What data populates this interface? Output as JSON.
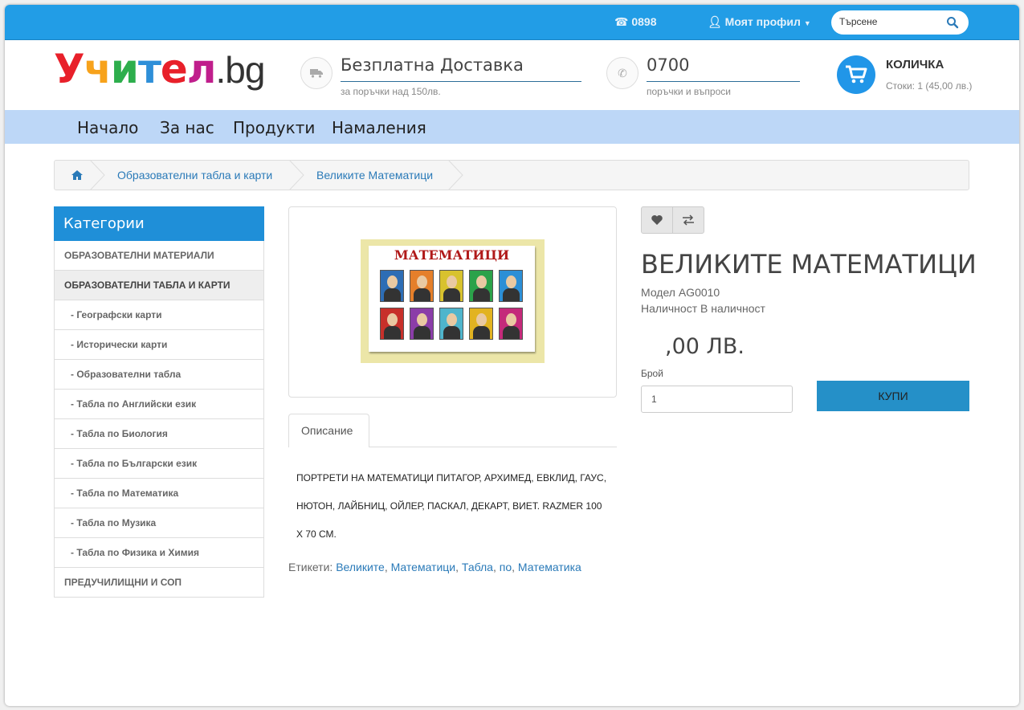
{
  "topbar": {
    "phone": "0898",
    "profile": "Моят профил",
    "search_placeholder": "Търсене"
  },
  "header": {
    "logo_letters": [
      "У",
      "ч",
      "и",
      "т",
      "е",
      "л"
    ],
    "logo_colors": [
      "#e8202a",
      "#f7a21b",
      "#2dae4c",
      "#2e8fd8",
      "#e8202a",
      "#c01e8c"
    ],
    "logo_suffix": ".bg",
    "delivery_title": "Безплатна Доставка",
    "delivery_sub": "за поръчки над 150лв.",
    "phone_title": "0700 ",
    "phone_sub": "поръчки и въпроси",
    "cart_title": "КОЛИЧКА",
    "cart_sub": "Стоки: 1 (45,00 лв.)"
  },
  "nav": {
    "items": [
      "Начало",
      "За нас",
      "Продукти",
      "Намаления"
    ]
  },
  "breadcrumb": {
    "items": [
      "Образователни табла и карти",
      "Великите Математици"
    ]
  },
  "sidebar": {
    "title": "Категории",
    "items": [
      "ОБРАЗОВАТЕЛНИ МАТЕРИАЛИ",
      "ОБРАЗОВАТЕЛНИ ТАБЛА И КАРТИ",
      "- Географски карти",
      "- Исторически карти",
      "- Образователни табла",
      "- Табла по Английски език",
      "- Табла по Биология",
      "- Табла по Български език",
      "- Табла по Математика",
      "- Табла по Музика",
      "- Табла по Физика и Химия",
      "ПРЕДУЧИЛИЩНИ И СОП"
    ]
  },
  "product": {
    "poster_title": "МАТЕМАТИЦИ",
    "title": "ВЕЛИКИТЕ МАТЕМАТИЦИ",
    "model": "Модел AG0010",
    "availability": "Наличност В наличност",
    "price": ",00 ЛВ.",
    "qty_label": "Брой",
    "qty_value": "1",
    "buy_label": "КУПИ"
  },
  "description": {
    "tab_label": "Описание",
    "line1": "ПОРТРЕТИ НА МАТЕМАТИЦИ ПИТАГОР, АРХИМЕД, ЕВКЛИД, ГАУС,",
    "line2": "НЮТОН, ЛАЙБНИЦ, ОЙЛЕР, ПАСКАЛ, ДЕКАРТ, ВИЕТ. RAZMER 100",
    "line3": "Х 70 СМ.",
    "tags_label": "Етикети:",
    "tags": [
      "Великите",
      "Математици",
      "Табла",
      "по",
      "Математика"
    ]
  },
  "colors": {
    "topbar": "#229de6",
    "nav": "#bdd7f7",
    "accent": "#1f8fd8",
    "buy": "#2590c8",
    "portraits": [
      "#2d6db5",
      "#e57f2a",
      "#d8c22e",
      "#2ba24a",
      "#2c8fd6",
      "#c7302a",
      "#8b3da8",
      "#4fb5cc",
      "#e2b321",
      "#c42a7a"
    ]
  }
}
